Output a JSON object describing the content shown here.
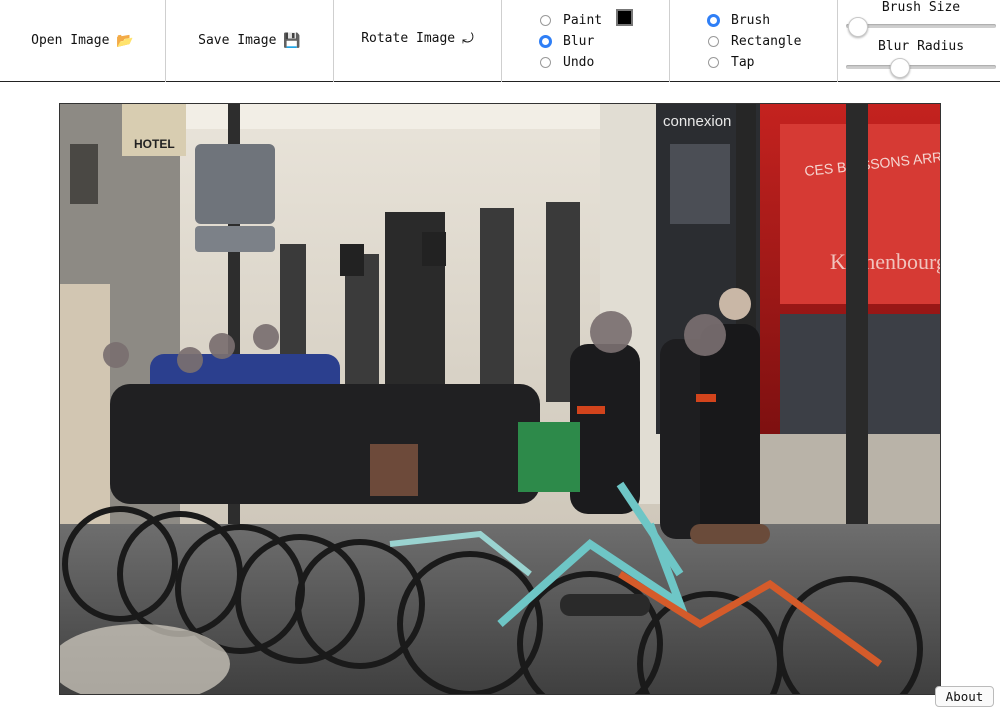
{
  "toolbar": {
    "open_label": "Open Image",
    "save_label": "Save Image",
    "rotate_label": "Rotate Image",
    "open_icon": "folder-icon",
    "save_icon": "floppy-disk-icon",
    "rotate_icon": "rotate-icon",
    "modes": [
      {
        "label": "Paint",
        "checked": false
      },
      {
        "label": "Blur",
        "checked": true
      },
      {
        "label": "Undo",
        "checked": false
      }
    ],
    "paint_color": "#000000",
    "tools": [
      {
        "label": "Brush",
        "checked": true
      },
      {
        "label": "Rectangle",
        "checked": false
      },
      {
        "label": "Tap",
        "checked": false
      }
    ],
    "brush_size_label": "Brush Size",
    "brush_size_fraction": 0.07,
    "blur_radius_label": "Blur Radius",
    "blur_radius_fraction": 0.35,
    "accent": "#2f7ff6"
  },
  "footer": {
    "about_label": "About"
  }
}
